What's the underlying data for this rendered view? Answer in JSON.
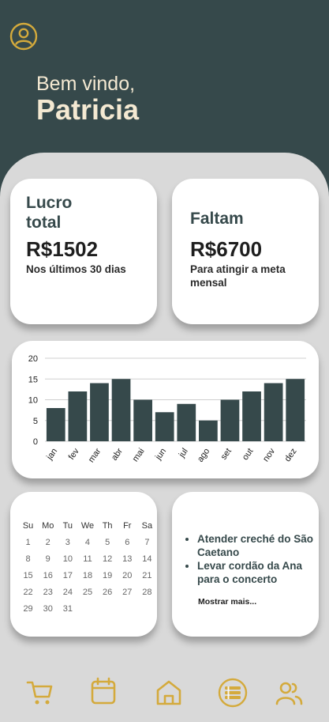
{
  "header": {
    "greeting": "Bem vindo,",
    "user_name": "Patricia",
    "profile_icon": "user-circle-icon"
  },
  "summary": {
    "profit": {
      "title": "Lucro total",
      "value": "R$1502",
      "subtitle": "Nos últimos 30 dias"
    },
    "remaining": {
      "title": "Faltam",
      "value": "R$6700",
      "subtitle": "Para atingir a meta mensal"
    }
  },
  "chart_data": {
    "type": "bar",
    "categories": [
      "jan",
      "fev",
      "mar",
      "abr",
      "mai",
      "jun",
      "jul",
      "ago",
      "set",
      "out",
      "nov",
      "dez"
    ],
    "values": [
      8,
      12,
      14,
      15,
      10,
      7,
      9,
      5,
      10,
      12,
      14,
      15
    ],
    "ylim": [
      0,
      20
    ],
    "yticks": [
      0,
      5,
      10,
      15,
      20
    ],
    "grid": true,
    "bar_color": "#36494b",
    "title": "",
    "xlabel": "",
    "ylabel": ""
  },
  "calendar": {
    "weekdays": [
      "Su",
      "Mo",
      "Tu",
      "We",
      "Th",
      "Fr",
      "Sa"
    ],
    "weeks": [
      [
        "1",
        "2",
        "3",
        "4",
        "5",
        "6",
        "7"
      ],
      [
        "8",
        "9",
        "10",
        "11",
        "12",
        "13",
        "14"
      ],
      [
        "15",
        "16",
        "17",
        "18",
        "19",
        "20",
        "21"
      ],
      [
        "22",
        "23",
        "24",
        "25",
        "26",
        "27",
        "28"
      ],
      [
        "29",
        "30",
        "31",
        "",
        "",
        "",
        ""
      ]
    ]
  },
  "tasks": {
    "items": [
      "Atender creché do São Caetano",
      "Levar cordão da Ana para o concerto"
    ],
    "more_label": "Mostrar mais..."
  },
  "nav": {
    "items": [
      {
        "icon": "cart-icon",
        "active": false
      },
      {
        "icon": "calendar-icon",
        "active": false
      },
      {
        "icon": "home-icon",
        "active": false
      },
      {
        "icon": "list-icon",
        "active": true
      },
      {
        "icon": "users-icon",
        "active": false
      }
    ]
  },
  "colors": {
    "header": "#36494b",
    "accent": "#d4aa3c",
    "background": "#d9d9d9",
    "text_light": "#f4e9d2"
  }
}
